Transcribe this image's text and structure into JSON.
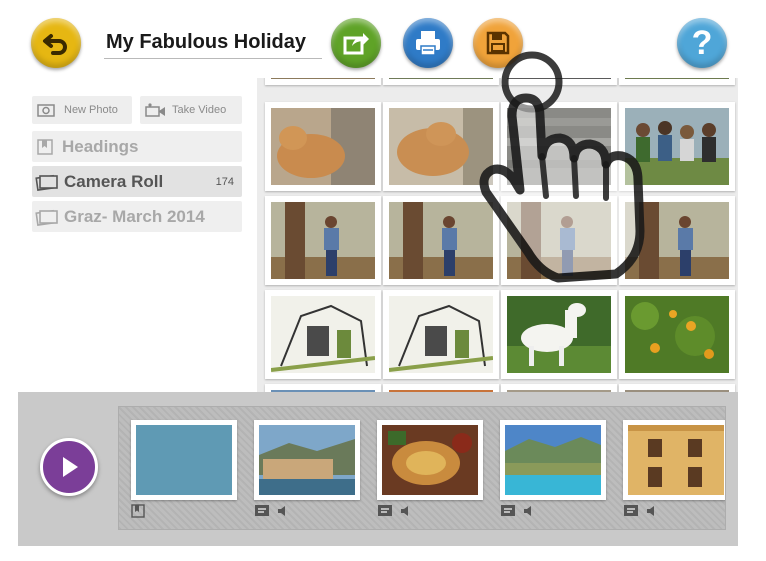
{
  "header": {
    "title": "My Fabulous Holiday",
    "back_icon": "back-arrow-icon",
    "share_icon": "share-icon",
    "print_icon": "print-icon",
    "save_icon": "save-icon",
    "help_icon": "help-icon",
    "help_glyph": "?"
  },
  "sidebar": {
    "new_photo_label": "New Photo",
    "take_video_label": "Take Video",
    "items": [
      {
        "label": "Headings",
        "icon": "bookmark-icon",
        "count": ""
      },
      {
        "label": "Camera Roll",
        "icon": "photos-icon",
        "count": "174"
      },
      {
        "label": "Graz- March 2014",
        "icon": "photos-icon",
        "count": ""
      }
    ]
  },
  "photo_grid": {
    "rows": [
      [
        "orange-cat",
        "orange-cat",
        "wood-deck",
        "group-of-women"
      ],
      [
        "woman-by-tree",
        "woman-by-tree",
        "woman-by-tree",
        "woman-by-tree"
      ],
      [
        "sketch-drawing",
        "sketch-drawing",
        "white-goat",
        "orange-tree"
      ]
    ]
  },
  "storyboard": {
    "slides": [
      {
        "kind": "heading",
        "color": "#5f9ab4",
        "icons": [
          "bookmark-icon"
        ]
      },
      {
        "kind": "coastal-town",
        "icons": [
          "caption-icon",
          "audio-icon"
        ]
      },
      {
        "kind": "food-platter",
        "icons": [
          "caption-icon",
          "audio-icon"
        ]
      },
      {
        "kind": "swimming-pool",
        "icons": [
          "caption-icon",
          "audio-icon"
        ]
      },
      {
        "kind": "yellow-building",
        "icons": [
          "caption-icon",
          "audio-icon"
        ]
      }
    ]
  },
  "overlay": {
    "icon": "tap-hand-icon"
  },
  "colors": {
    "back": "#e6b712",
    "share": "#5fa327",
    "print": "#2f7bc7",
    "save": "#f0a33a",
    "help": "#4fa6d8",
    "play": "#7b3e98"
  }
}
